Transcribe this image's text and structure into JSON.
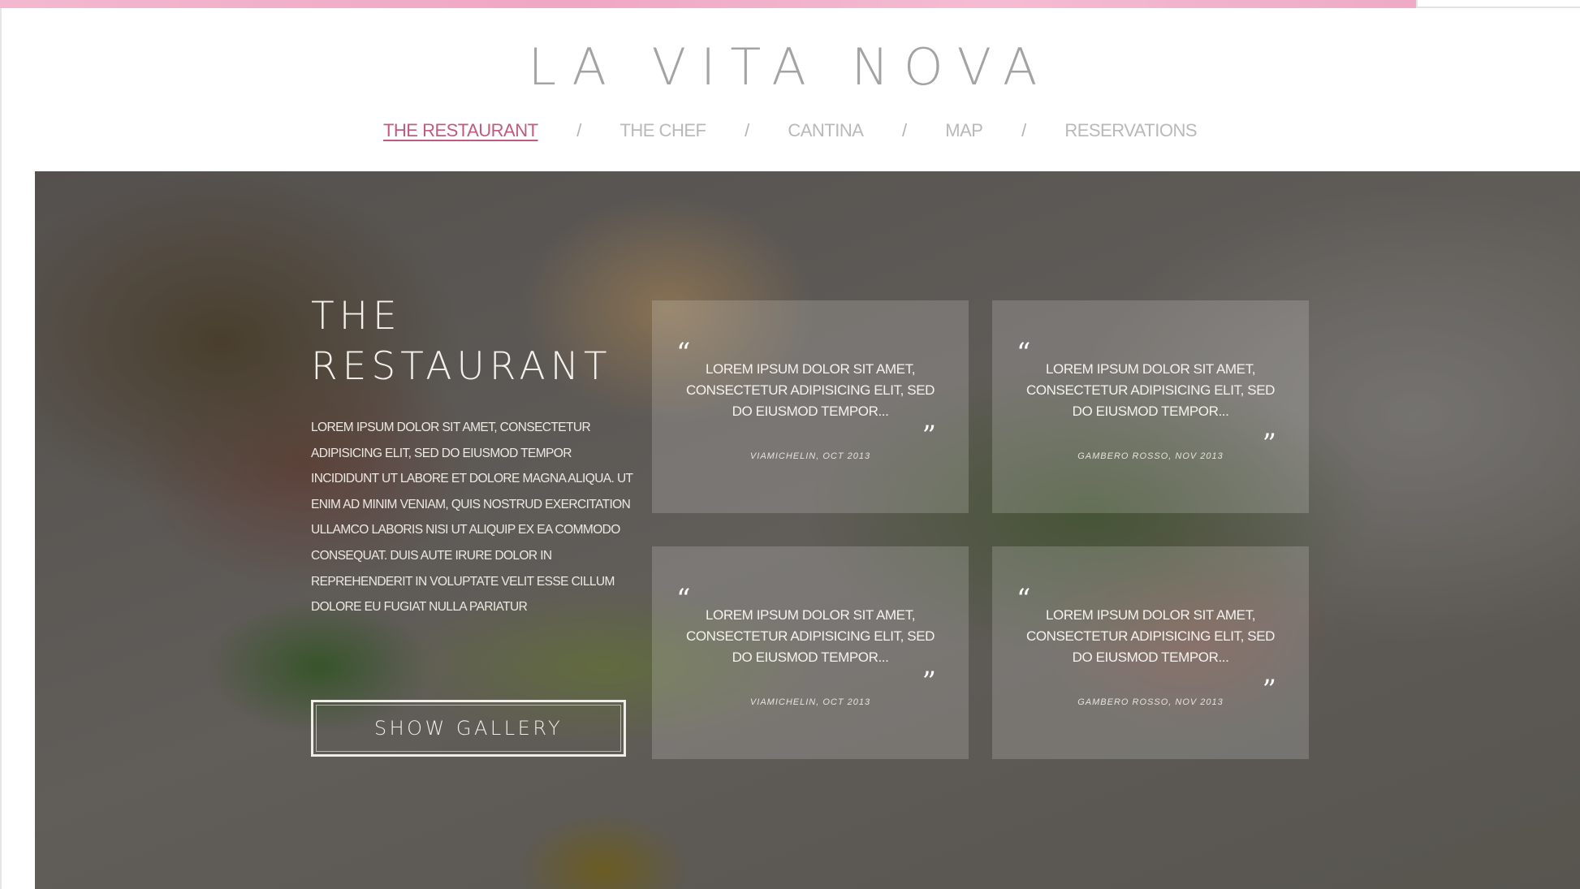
{
  "site": {
    "logo": "LA VITA NOVA"
  },
  "nav": {
    "items": [
      {
        "label": "THE RESTAURANT",
        "active": true
      },
      {
        "label": "THE CHEF",
        "active": false
      },
      {
        "label": "CANTINA",
        "active": false
      },
      {
        "label": "MAP",
        "active": false
      },
      {
        "label": "RESERVATIONS",
        "active": false
      }
    ],
    "separator": "/",
    "active_color": "#c05b7d"
  },
  "hero": {
    "title_line1": "THE",
    "title_line2": "RESTAURANT",
    "body": "LOREM IPSUM DOLOR SIT AMET, CONSECTETUR ADIPISICING ELIT, SED DO EIUSMOD TEMPOR INCIDIDUNT UT LABORE ET DOLORE MAGNA ALIQUA. UT ENIM AD MINIM VENIAM, QUIS NOSTRUD EXERCITATION ULLAMCO LABORIS NISI UT ALIQUIP EX EA COMMODO CONSEQUAT. DUIS AUTE IRURE DOLOR IN REPREHENDERIT IN VOLUPTATE VELIT ESSE CILLUM DOLORE EU FUGIAT NULLA PARIATUR",
    "button_label": "SHOW GALLERY",
    "background_image": "plated-lamb-chop-with-greens"
  },
  "quotes": [
    {
      "text": "LOREM IPSUM DOLOR SIT AMET, CONSECTETUR ADIPISICING ELIT, SED DO EIUSMOD TEMPOR...",
      "source": "VIAMICHELIN, OCT 2013"
    },
    {
      "text": "LOREM IPSUM DOLOR SIT AMET, CONSECTETUR ADIPISICING ELIT, SED DO EIUSMOD TEMPOR...",
      "source": "GAMBERO ROSSO, NOV 2013"
    },
    {
      "text": "LOREM IPSUM DOLOR SIT AMET, CONSECTETUR ADIPISICING ELIT, SED DO EIUSMOD TEMPOR...",
      "source": "VIAMICHELIN, OCT 2013"
    },
    {
      "text": "LOREM IPSUM DOLOR SIT AMET, CONSECTETUR ADIPISICING ELIT, SED DO EIUSMOD TEMPOR...",
      "source": "GAMBERO ROSSO, NOV 2013"
    }
  ],
  "quote_marks": {
    "open": "“",
    "close": "”"
  },
  "colors": {
    "accent": "#c05b7d",
    "top_strip": "#efa7c3",
    "logo": "#a3a3a3",
    "nav": "#b9b9b9"
  }
}
